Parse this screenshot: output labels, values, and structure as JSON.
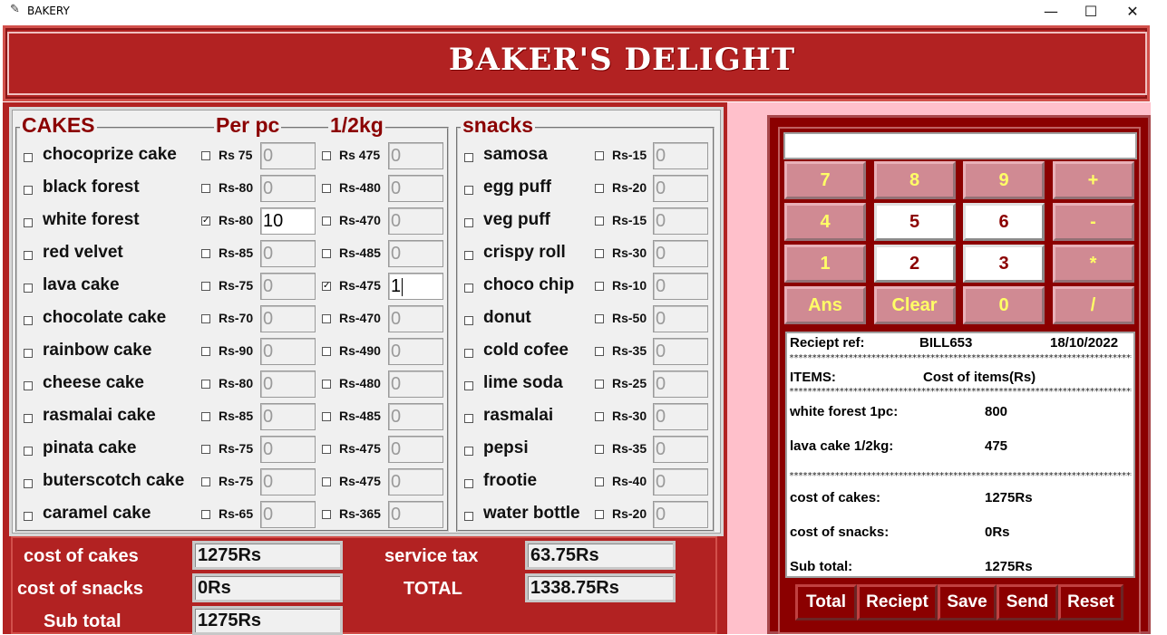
{
  "window": {
    "title": "BAKERY",
    "minimize": "—",
    "maximize": "☐",
    "close": "✕"
  },
  "header": {
    "title": "BAKER'S DELIGHT"
  },
  "cakes": {
    "legend": "CAKES",
    "per_pc_label": "Per pc",
    "half_kg_label": "1/2kg",
    "items": [
      {
        "name": "chocoprize cake",
        "checked": "",
        "pc_price": "Rs 75",
        "pc_qty": "0",
        "kg_checked": "",
        "kg_price": "Rs 475",
        "kg_qty": "0"
      },
      {
        "name": "black forest",
        "checked": "",
        "pc_price": "Rs-80",
        "pc_qty": "0",
        "kg_checked": "",
        "kg_price": "Rs-480",
        "kg_qty": "0"
      },
      {
        "name": "white forest",
        "checked": "",
        "pc_price": "Rs-80",
        "pc_qty": "10",
        "kg_checked": "",
        "kg_price": "Rs-470",
        "kg_qty": "0"
      },
      {
        "name": "red velvet",
        "checked": "",
        "pc_price": "Rs-85",
        "pc_qty": "0",
        "kg_checked": "",
        "kg_price": "Rs-485",
        "kg_qty": "0"
      },
      {
        "name": "lava cake",
        "checked": "",
        "pc_price": "Rs-75",
        "pc_qty": "0",
        "kg_checked": "",
        "kg_price": "Rs-475",
        "kg_qty": "1"
      },
      {
        "name": "chocolate cake",
        "checked": "",
        "pc_price": "Rs-70",
        "pc_qty": "0",
        "kg_checked": "",
        "kg_price": "Rs-470",
        "kg_qty": "0"
      },
      {
        "name": "rainbow cake",
        "checked": "",
        "pc_price": "Rs-90",
        "pc_qty": "0",
        "kg_checked": "",
        "kg_price": "Rs-490",
        "kg_qty": "0"
      },
      {
        "name": "cheese cake",
        "checked": "",
        "pc_price": "Rs-80",
        "pc_qty": "0",
        "kg_checked": "",
        "kg_price": "Rs-480",
        "kg_qty": "0"
      },
      {
        "name": "rasmalai cake",
        "checked": "",
        "pc_price": "Rs-85",
        "pc_qty": "0",
        "kg_checked": "",
        "kg_price": "Rs-485",
        "kg_qty": "0"
      },
      {
        "name": "pinata cake",
        "checked": "",
        "pc_price": "Rs-75",
        "pc_qty": "0",
        "kg_checked": "",
        "kg_price": "Rs-475",
        "kg_qty": "0"
      },
      {
        "name": "buterscotch cake",
        "checked": "",
        "pc_price": "Rs-75",
        "pc_qty": "0",
        "kg_checked": "",
        "kg_price": "Rs-475",
        "kg_qty": "0"
      },
      {
        "name": "caramel cake",
        "checked": "",
        "pc_price": "Rs-65",
        "pc_qty": "0",
        "kg_checked": "",
        "kg_price": "Rs-365",
        "kg_qty": "0"
      }
    ]
  },
  "snacks": {
    "legend": "snacks",
    "items": [
      {
        "name": "samosa",
        "checked": "",
        "price": "Rs-15",
        "qty": "0"
      },
      {
        "name": "egg puff",
        "checked": "",
        "price": "Rs-20",
        "qty": "0"
      },
      {
        "name": "veg puff",
        "checked": "",
        "price": "Rs-15",
        "qty": "0"
      },
      {
        "name": "crispy roll",
        "checked": "",
        "price": "Rs-30",
        "qty": "0"
      },
      {
        "name": "choco chip",
        "checked": "",
        "price": "Rs-10",
        "qty": "0"
      },
      {
        "name": "donut",
        "checked": "",
        "price": "Rs-50",
        "qty": "0"
      },
      {
        "name": "cold cofee",
        "checked": "",
        "price": "Rs-35",
        "qty": "0"
      },
      {
        "name": "lime soda",
        "checked": "",
        "price": "Rs-25",
        "qty": "0"
      },
      {
        "name": "rasmalai",
        "checked": "",
        "price": "Rs-30",
        "qty": "0"
      },
      {
        "name": "pepsi",
        "checked": "",
        "price": "Rs-35",
        "qty": "0"
      },
      {
        "name": "frootie",
        "checked": "",
        "price": "Rs-40",
        "qty": "0"
      },
      {
        "name": "water bottle",
        "checked": "",
        "price": "Rs-20",
        "qty": "0"
      }
    ]
  },
  "checked_state": {
    "cakes_pc": [
      false,
      false,
      true,
      false,
      false,
      false,
      false,
      false,
      false,
      false,
      false,
      false
    ],
    "cakes_kg": [
      false,
      false,
      false,
      false,
      true,
      false,
      false,
      false,
      false,
      false,
      false,
      false
    ]
  },
  "totals": {
    "cost_of_cakes_label": "cost of cakes",
    "cost_of_cakes": "1275Rs",
    "cost_of_snacks_label": "cost of snacks",
    "cost_of_snacks": "0Rs",
    "sub_total_label": "Sub total",
    "sub_total": "1275Rs",
    "service_tax_label": "service tax",
    "service_tax": "63.75Rs",
    "total_label": "TOTAL",
    "total": "1338.75Rs"
  },
  "calculator": {
    "display": "",
    "keys": [
      "7",
      "8",
      "9",
      "+",
      "4",
      "5",
      "6",
      "-",
      "1",
      "2",
      "3",
      "*",
      "Ans",
      "Clear",
      "0",
      "/"
    ]
  },
  "receipt": {
    "ref_label": "Reciept ref:",
    "ref": "BILL653",
    "date": "18/10/2022",
    "items_label": "ITEMS:",
    "cost_label": "Cost of items(Rs)",
    "lines": [
      {
        "item": "white forest 1pc:",
        "cost": "800"
      },
      {
        "item": "lava cake 1/2kg:",
        "cost": "475"
      }
    ],
    "cost_of_cakes_label": "cost of cakes:",
    "cost_of_cakes": "1275Rs",
    "cost_of_snacks_label": "cost of snacks:",
    "cost_of_snacks": "0Rs",
    "sub_total_label": "Sub total:",
    "sub_total": "1275Rs",
    "stars": "**********************************************************************************************"
  },
  "actions": {
    "total": "Total",
    "receipt": "Reciept",
    "save": "Save",
    "send": "Send",
    "reset": "Reset"
  },
  "colors": {
    "brand_red": "#b22222",
    "dark_red": "#8b0000",
    "pink": "#ffc0cb",
    "key_pink": "#d08a93",
    "key_text": "#ffff66"
  }
}
